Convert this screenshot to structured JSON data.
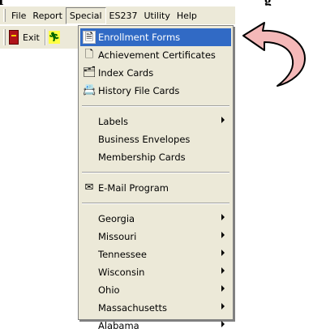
{
  "top_strip": {
    "left_fragment": "I",
    "right_fragment": "g"
  },
  "menubar": {
    "items": [
      {
        "label": "File",
        "active": false
      },
      {
        "label": "Report",
        "active": false
      },
      {
        "label": "Special",
        "active": true
      },
      {
        "label": "ES237",
        "active": false
      },
      {
        "label": "Utility",
        "active": false
      },
      {
        "label": "Help",
        "active": false
      }
    ]
  },
  "toolbar": {
    "exit_label": "Exit",
    "exit_icon": "exit-door-icon",
    "run_icon": "running-man-icon"
  },
  "special_menu": {
    "group1": [
      {
        "label": "Enrollment Forms",
        "icon": "document-icon",
        "selected": true
      },
      {
        "label": "Achievement Certificates",
        "icon": "certificate-icon"
      },
      {
        "label": "Index Cards",
        "icon": "index-cards-icon"
      },
      {
        "label": "History File Cards",
        "icon": "history-cards-icon"
      }
    ],
    "group2": [
      {
        "label": "Labels",
        "submenu": true
      },
      {
        "label": "Business Envelopes"
      },
      {
        "label": "Membership Cards"
      }
    ],
    "group3": [
      {
        "label": "E-Mail Program",
        "icon": "email-icon"
      }
    ],
    "group4": [
      {
        "label": "Georgia",
        "submenu": true
      },
      {
        "label": "Missouri",
        "submenu": true
      },
      {
        "label": "Tennessee",
        "submenu": true
      },
      {
        "label": "Wisconsin",
        "submenu": true
      },
      {
        "label": "Ohio",
        "submenu": true
      },
      {
        "label": "Massachusetts",
        "submenu": true
      },
      {
        "label": "Alabama",
        "submenu": true
      }
    ]
  },
  "colors": {
    "menu_bg": "#ece9d8",
    "highlight": "#316ac5",
    "arrow_fill": "#f4b8b8"
  }
}
